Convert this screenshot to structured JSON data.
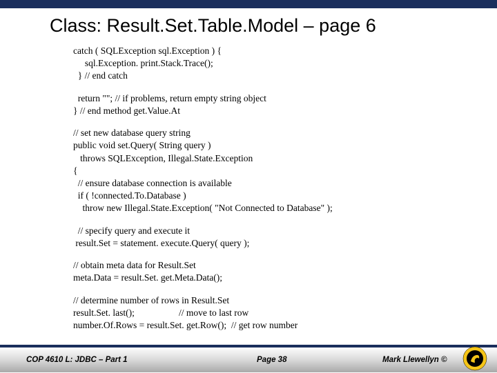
{
  "title": "Class:  Result.Set.Table.Model – page 6",
  "code": {
    "b1l1": "catch ( SQLException sql.Exception ) {",
    "b1l2": "     sql.Exception. print.Stack.Trace();",
    "b1l3": "  } // end catch",
    "b2l1": "  return \"\"; // if problems, return empty string object",
    "b2l2": "} // end method get.Value.At",
    "b3l1": "// set new database query string",
    "b3l2": "public void set.Query( String query )",
    "b3l3": "   throws SQLException, Illegal.State.Exception",
    "b3l4": "{",
    "b3l5": "  // ensure database connection is available",
    "b3l6": "  if ( !connected.To.Database )",
    "b3l7": "    throw new Illegal.State.Exception( \"Not Connected to Database\" );",
    "b4l1": "  // specify query and execute it",
    "b4l2": " result.Set = statement. execute.Query( query );",
    "b5l1": "// obtain meta data for Result.Set",
    "b5l2": "meta.Data = result.Set. get.Meta.Data();",
    "b6l1": "// determine number of rows in Result.Set",
    "b6l2": "result.Set. last();                   // move to last row",
    "b6l3": "number.Of.Rows = result.Set. get.Row();  // get row number"
  },
  "footer": {
    "left": "COP 4610 L: JDBC – Part 1",
    "center": "Page 38",
    "right": "Mark Llewellyn ©"
  }
}
